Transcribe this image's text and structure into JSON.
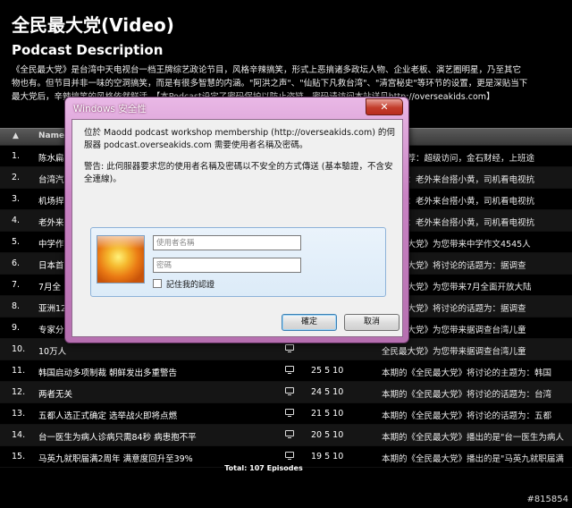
{
  "page": {
    "title": "全民最大党(Video)",
    "section_title": "Podcast Description",
    "description_lines": [
      "《全民最大党》是台湾中天电视台一档王牌综艺政论节目，风格辛辣搞笑，形式上恶搞诸多政坛人物、企业老板、演艺圈明星，乃至其它",
      "物也有。但节目并非一味的空洞搞笑，而是有很多智慧的内涵。\"阿洪之声\"、\"仙贴下凡救台湾\"、\"清宫秘史\"等环节的设置，更是深贴当下",
      "最大党后，辛辣搞笑的风格依然鲜活。【本Podcast设定了密码保护以防止盗链，密码请访问本站详见http://overseakids.com】"
    ]
  },
  "table": {
    "sort_icon": "▲",
    "col_name": "Name",
    "col_desc": "n",
    "rows": [
      {
        "num": "1.",
        "name": "陈水扁",
        "date": "",
        "desc": "新品推荐：超级访问，金石财经，上班途"
      },
      {
        "num": "2.",
        "name": "台湾汽",
        "date": "",
        "desc": "目内容：老外来台搭小黄，司机看电视抗"
      },
      {
        "num": "3.",
        "name": "机场捍",
        "date": "",
        "desc": "目内容：老外来台搭小黄，司机看电视抗"
      },
      {
        "num": "4.",
        "name": "老外来",
        "date": "",
        "desc": "目内容：老外来台搭小黄，司机看电视抗"
      },
      {
        "num": "5.",
        "name": "中学作",
        "date": "",
        "desc": "全民最大党》为您带来中学作文4545人"
      },
      {
        "num": "6.",
        "name": "日本首",
        "date": "",
        "desc": "全民最大党》将讨论的话题为：据调查"
      },
      {
        "num": "7.",
        "name": "7月全",
        "date": "",
        "desc": "全民最大党》为您带来7月全面开放大陆"
      },
      {
        "num": "8.",
        "name": "亚洲12",
        "date": "",
        "desc": "全民最大党》将讨论的话题为：据调查"
      },
      {
        "num": "9.",
        "name": "专家分",
        "date": "",
        "desc": "全民最大党》为您带来据调查台湾儿童"
      },
      {
        "num": "10.",
        "name": "10万人",
        "date": "",
        "desc": "全民最大党》为您带来据调查台湾儿童"
      },
      {
        "num": "11.",
        "name": "韩国启动多项制裁 朝鲜发出多重警告",
        "date": "25 5 10",
        "desc": "本期的《全民最大党》将讨论的主题为：韩国"
      },
      {
        "num": "12.",
        "name": "两者无关",
        "date": "24 5 10",
        "desc": "本期的《全民最大党》将讨论的话题为：台湾"
      },
      {
        "num": "13.",
        "name": "五都人选正式确定 选举战火即将点燃",
        "date": "21 5 10",
        "desc": "本期的《全民最大党》将讨论的话题为：五都"
      },
      {
        "num": "14.",
        "name": "台一医生为病人诊病只需84秒 病患抱不平",
        "date": "20 5 10",
        "desc": "本期的《全民最大党》播出的是\"台一医生为病人"
      },
      {
        "num": "15.",
        "name": "马英九就职届满2周年 满意度回升至39%",
        "date": "19 5 10",
        "desc": "本期的《全民最大党》播出的是\"马英九就职届满"
      }
    ],
    "total": "Total: 107 Episodes"
  },
  "dialog": {
    "title": "Windows 安全性",
    "close_label": "✕",
    "message_1": "位於 Maodd podcast workshop membership (http://overseakids.com) 的伺服器 podcast.overseakids.com 需要使用者名稱及密碼。",
    "message_2": "警告: 此伺服器要求您的使用者名稱及密碼以不安全的方式傳送 (基本驗證，不含安全連線)。",
    "username_placeholder": "使用者名稱",
    "password_placeholder": "密碼",
    "remember_label": "記住我的認證",
    "ok_label": "確定",
    "cancel_label": "取消"
  },
  "watermark": "#815854"
}
